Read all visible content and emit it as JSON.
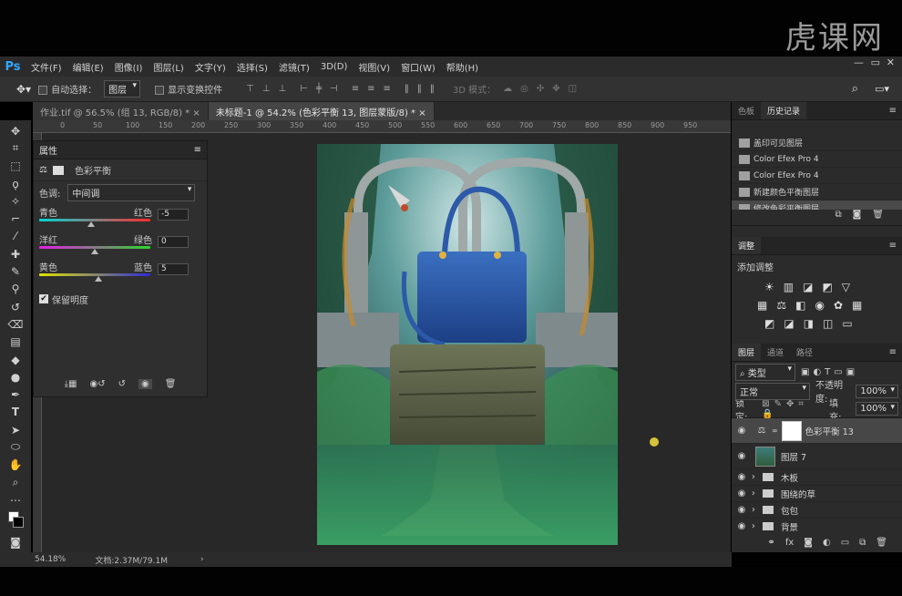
{
  "watermark": "虎课网",
  "app": {
    "logo": "Ps"
  },
  "menu": [
    "文件(F)",
    "编辑(E)",
    "图像(I)",
    "图层(L)",
    "文字(Y)",
    "选择(S)",
    "滤镜(T)",
    "3D(D)",
    "视图(V)",
    "窗口(W)",
    "帮助(H)"
  ],
  "options": {
    "auto_select_label": "自动选择：",
    "auto_select_value": "图层",
    "show_transform_label": "显示变换控件",
    "mode_3d_label": "3D 模式："
  },
  "tabs": [
    {
      "label": "作业.tif @ 56.5% (组 13, RGB/8) *",
      "close": "×"
    },
    {
      "label": "未标题-1 @ 54.2% (色彩平衡 13, 图层蒙版/8) *",
      "close": "×"
    }
  ],
  "ruler": [
    "0",
    "50",
    "100",
    "150",
    "200",
    "250",
    "300",
    "350",
    "400",
    "450",
    "500",
    "550",
    "600",
    "650",
    "700",
    "750",
    "800",
    "850",
    "900",
    "950"
  ],
  "properties": {
    "title": "属性",
    "panel_name": "色彩平衡",
    "tone_label": "色调:",
    "tone_value": "中间调",
    "sliders": [
      {
        "left": "青色",
        "right": "红色",
        "value": "-5",
        "fraction": 0.47
      },
      {
        "left": "洋红",
        "right": "绿色",
        "value": "0",
        "fraction": 0.5
      },
      {
        "left": "黄色",
        "right": "蓝色",
        "value": "5",
        "fraction": 0.53
      }
    ],
    "preserve_luminosity": "保留明度"
  },
  "history": {
    "tabs": [
      "色板",
      "历史记录"
    ],
    "items": [
      "盖印可见图层",
      "Color Efex Pro 4",
      "Color Efex Pro 4",
      "新建颜色平衡图层",
      "修改色彩平衡图层"
    ]
  },
  "adjustments": {
    "tab": "调整",
    "add_label": "添加调整"
  },
  "layers": {
    "tabs": [
      "图层",
      "通道",
      "路径"
    ],
    "filter_value": "类型",
    "blend_mode": "正常",
    "opacity_label": "不透明度:",
    "opacity_value": "100%",
    "lock_label": "锁定:",
    "fill_label": "填充:",
    "fill_value": "100%",
    "items": [
      {
        "name": "色彩平衡 13",
        "kind": "adjust"
      },
      {
        "name": "图层 7",
        "kind": "pixel"
      },
      {
        "name": "木板",
        "kind": "group"
      },
      {
        "name": "围绕的草",
        "kind": "group"
      },
      {
        "name": "包包",
        "kind": "group"
      },
      {
        "name": "背景",
        "kind": "group"
      }
    ]
  },
  "status": {
    "zoom": "54.18%",
    "doc": "文档:2.37M/79.1M"
  }
}
